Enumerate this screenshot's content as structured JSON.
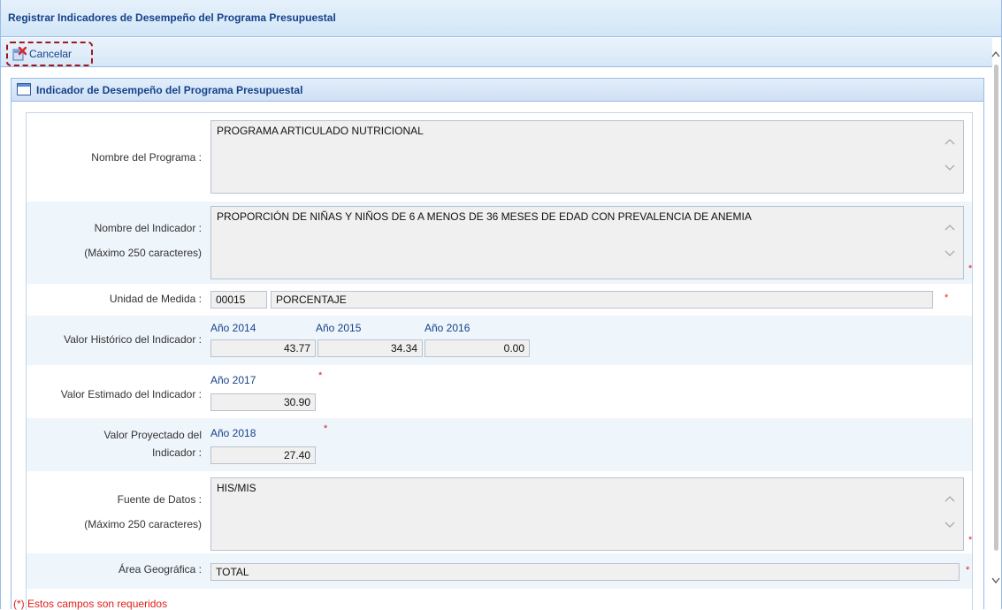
{
  "window": {
    "title": "Registrar Indicadores de Desempeño del Programa Presupuestal"
  },
  "toolbar": {
    "cancel_label": "Cancelar"
  },
  "panel": {
    "title": "Indicador de Desempeño del Programa Presupuestal"
  },
  "form": {
    "programa_label": "Nombre del Programa :",
    "programa_value": "PROGRAMA ARTICULADO NUTRICIONAL",
    "indicador_label": "Nombre del Indicador :",
    "indicador_hint": "(Máximo 250 caracteres)",
    "indicador_value": "PROPORCIÓN DE NIÑAS Y NIÑOS DE 6 A MENOS DE 36 MESES DE EDAD CON PREVALENCIA DE ANEMIA",
    "unidad_label": "Unidad de Medida :",
    "unidad_code": "00015",
    "unidad_name": "PORCENTAJE",
    "historico_label": "Valor Histórico del Indicador :",
    "historico": [
      {
        "year": "Año 2014",
        "value": "43.77"
      },
      {
        "year": "Año 2015",
        "value": "34.34"
      },
      {
        "year": "Año 2016",
        "value": "0.00"
      }
    ],
    "estimado_label": "Valor Estimado del Indicador :",
    "estimado_year": "Año 2017",
    "estimado_value": "30.90",
    "proyectado_label_1": "Valor Proyectado del",
    "proyectado_label_2": "Indicador :",
    "proyectado_year": "Año 2018",
    "proyectado_value": "27.40",
    "fuente_label": "Fuente de Datos :",
    "fuente_hint": "(Máximo 250 caracteres)",
    "fuente_value": "HIS/MIS",
    "area_label": "Área Geográfica :",
    "area_value": "TOTAL",
    "required_mark": "*"
  },
  "footer": {
    "note": "(*) Estos campos son requeridos"
  },
  "colors": {
    "header_text": "#15428b",
    "required": "#e02020",
    "highlight_border": "#a0161d"
  }
}
